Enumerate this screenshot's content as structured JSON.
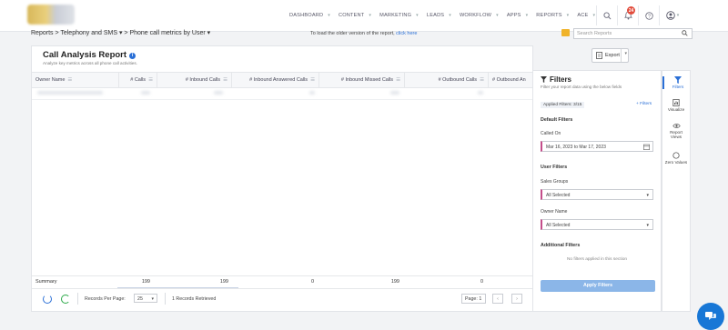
{
  "nav": {
    "links": [
      "DASHBOARD",
      "CONTENT",
      "MARKETING",
      "LEADS",
      "WORKFLOW",
      "APPS",
      "REPORTS",
      "ACE"
    ],
    "notification_count": "24"
  },
  "breadcrumb": "Reports > Telephony and SMS ▾ > Phone call metrics by User ▾",
  "old_version": {
    "text": "To load the older version of the report,",
    "link": "click here"
  },
  "search": {
    "placeholder": "Search Reports"
  },
  "report": {
    "title": "Call Analysis Report",
    "subtitle": "Analyze key metrics across all phone call activities.",
    "export_label": "Export",
    "columns": [
      "Owner Name",
      "# Calls",
      "# Inbound Calls",
      "# Inbound Answered Calls",
      "# Inbound Missed Calls",
      "# Outbound Calls",
      "# Outbound An"
    ],
    "summary": {
      "label": "Summary",
      "values": [
        "199",
        "199",
        "0",
        "199",
        "0"
      ]
    }
  },
  "pager": {
    "per_page_label": "Records Per Page:",
    "per_page_value": "25",
    "retrieved": "1 Records Retrieved",
    "page_label": "Page:",
    "page_value": "1"
  },
  "filters": {
    "title": "Filters",
    "subtitle": "Filter your report data using the below fields",
    "applied": "Applied Filters: 3/15",
    "add": "+ Filters",
    "default_heading": "Default Filters",
    "called_on_label": "Called On",
    "called_on_value": "Mar 16, 2023 to Mar 17, 2023",
    "user_heading": "User Filters",
    "sales_groups_label": "Sales Groups",
    "sales_groups_value": "All Selected",
    "owner_name_label": "Owner Name",
    "owner_name_value": "All Selected",
    "additional_heading": "Additional Filters",
    "no_filters": "No filters applied in this section",
    "apply_button": "Apply Filters"
  },
  "rail": {
    "filters": "Filters",
    "visualize": "Visualize",
    "report_views": "Report Views",
    "zero_values": "Zero Values"
  }
}
